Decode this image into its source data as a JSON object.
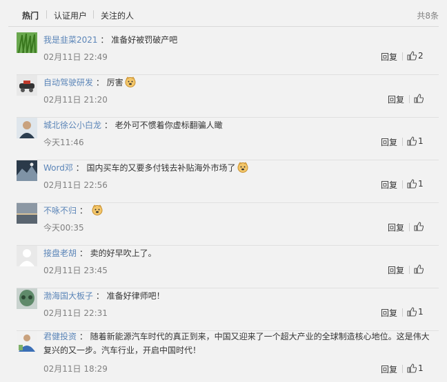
{
  "tabs": {
    "hot": "热门",
    "verified": "认证用户",
    "following": "关注的人"
  },
  "total": "共8条",
  "reply_label": "回复",
  "comments": [
    {
      "user": "我是韭菜2021",
      "text": "准备好被罚破产吧",
      "time": "02月11日 22:49",
      "likes": "2",
      "emoji": false
    },
    {
      "user": "自动驾驶研发",
      "text": "厉害",
      "time": "02月11日 21:20",
      "likes": "",
      "emoji": true
    },
    {
      "user": "城北徐公小白龙",
      "text": "老外可不惯着你虚标翻骗人瞰",
      "time": "今天11:46",
      "likes": "1",
      "emoji": false
    },
    {
      "user": "Word邓",
      "text": "国内买车的又要多付钱去补贴海外市场了",
      "time": "02月11日 22:56",
      "likes": "1",
      "emoji": true
    },
    {
      "user": "不咏不归",
      "text": "",
      "time": "今天00:35",
      "likes": "",
      "emoji": true
    },
    {
      "user": "接盘老胡",
      "text": "卖的好早吹上了。",
      "time": "02月11日 23:45",
      "likes": "",
      "emoji": false
    },
    {
      "user": "渤海国大板子",
      "text": "准备好律师吧！",
      "time": "02月11日 22:31",
      "likes": "1",
      "emoji": false
    },
    {
      "user": "君健投资",
      "text": "随着新能源汽车时代的真正到来，中国又迎来了一个超大产业的全球制造核心地位。这是伟大复兴的又一步。汽车行业，开启中国时代！",
      "time": "02月11日 18:29",
      "likes": "1",
      "emoji": false
    }
  ]
}
